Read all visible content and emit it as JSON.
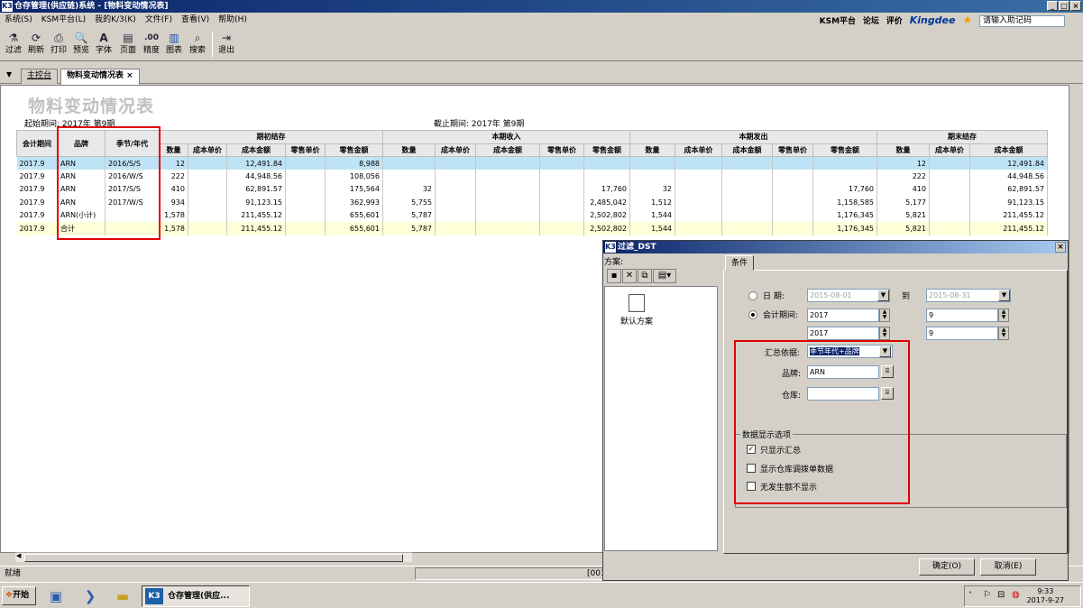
{
  "window": {
    "title": "仓存管理(供应链)系统 - [物料变动情况表]",
    "icon": "K3"
  },
  "menubar": {
    "items": [
      "系统(S)",
      "KSM平台(L)",
      "我的K/3(K)",
      "文件(F)",
      "查看(V)",
      "帮助(H)"
    ],
    "right": {
      "ksm": "KSM平台",
      "forum": "论坛",
      "rate": "评价",
      "brand": "Kingdee",
      "help_placeholder": "请输入助记码"
    }
  },
  "toolbar": {
    "items": [
      {
        "label": "过滤",
        "icon": "filter-icon",
        "glyph": "⚗"
      },
      {
        "label": "刷新",
        "icon": "refresh-icon",
        "glyph": "⟳"
      },
      {
        "label": "打印",
        "icon": "print-icon",
        "glyph": "⎙"
      },
      {
        "label": "预览",
        "icon": "preview-icon",
        "glyph": "🔍"
      },
      {
        "label": "字体",
        "icon": "font-icon",
        "glyph": "A"
      },
      {
        "label": "页面",
        "icon": "page-icon",
        "glyph": "▤"
      },
      {
        "label": "精度",
        "icon": "precision-icon",
        "glyph": ".00"
      },
      {
        "label": "图表",
        "icon": "chart-icon",
        "glyph": "▥"
      },
      {
        "label": "搜索",
        "icon": "search-icon",
        "glyph": "⌕"
      },
      {
        "label": "退出",
        "icon": "exit-icon",
        "glyph": "⇥"
      }
    ]
  },
  "tabs": [
    {
      "label": "主控台"
    },
    {
      "label": "物料变动情况表"
    }
  ],
  "tab_close": "×",
  "report": {
    "title": "物料变动情况表",
    "start_period": "起始期间: 2017年 第9期",
    "end_period": "截止期间: 2017年 第9期",
    "group_headers": [
      "期初结存",
      "本期收入",
      "本期发出",
      "期末结存"
    ],
    "left_headers": [
      "会计期间",
      "品牌",
      "季节/年代"
    ],
    "sub_headers": [
      "数量",
      "成本单价",
      "成本金额",
      "零售单价",
      "零售金额"
    ],
    "rows": [
      [
        "2017.9",
        "ARN",
        "2016/S/S",
        "12",
        "",
        "12,491.84",
        "",
        "8,988",
        "",
        "",
        "",
        "",
        "",
        "",
        "",
        "",
        "",
        "",
        "12",
        "",
        "12,491.84"
      ],
      [
        "2017.9",
        "ARN",
        "2016/W/S",
        "222",
        "",
        "44,948.56",
        "",
        "108,056",
        "",
        "",
        "",
        "",
        "",
        "",
        "",
        "",
        "",
        "",
        "222",
        "",
        "44,948.56"
      ],
      [
        "2017.9",
        "ARN",
        "2017/S/S",
        "410",
        "",
        "62,891.57",
        "",
        "175,564",
        "32",
        "",
        "",
        "",
        "17,760",
        "32",
        "",
        "",
        "",
        "17,760",
        "410",
        "",
        "62,891.57"
      ],
      [
        "2017.9",
        "ARN",
        "2017/W/S",
        "934",
        "",
        "91,123.15",
        "",
        "362,993",
        "5,755",
        "",
        "",
        "",
        "2,485,042",
        "1,512",
        "",
        "",
        "",
        "1,158,585",
        "5,177",
        "",
        "91,123.15"
      ],
      [
        "2017.9",
        "ARN(小计)",
        "",
        "1,578",
        "",
        "211,455.12",
        "",
        "655,601",
        "5,787",
        "",
        "",
        "",
        "2,502,802",
        "1,544",
        "",
        "",
        "",
        "1,176,345",
        "5,821",
        "",
        "211,455.12"
      ],
      [
        "2017.9",
        "合计",
        "",
        "1,578",
        "",
        "211,455.12",
        "",
        "655,601",
        "5,787",
        "",
        "",
        "",
        "2,502,802",
        "1,544",
        "",
        "",
        "",
        "1,176,345",
        "5,821",
        "",
        "211,455.12"
      ]
    ]
  },
  "statusbar": {
    "text": "就绪",
    "pane2": "[001"
  },
  "taskbar": {
    "start": "开始",
    "item": "仓存管理(供应...",
    "tray_time": "9:33",
    "tray_date": "2017-9-27"
  },
  "dialog": {
    "title": "过滤_DST",
    "scheme_label": "方案:",
    "scheme_default": "默认方案",
    "tab_label": "条件",
    "date_label": "日    期:",
    "date_from": "2015-08-01",
    "to_label": "到",
    "date_to": "2015-08-31",
    "period_label": "会计期间:",
    "period_year1": "2017",
    "period_no1": "9",
    "period_year2": "2017",
    "period_no2": "9",
    "group_by_label": "汇总依据:",
    "group_by_value": "季节年代+品牌",
    "brand_label": "品牌:",
    "brand_value": "ARN",
    "warehouse_label": "仓库:",
    "warehouse_value": "",
    "options_title": "数据显示选项",
    "options": [
      {
        "label": "只显示汇总",
        "checked": true
      },
      {
        "label": "显示仓库调拨单数据",
        "checked": false
      },
      {
        "label": "无发生额不显示",
        "checked": false
      }
    ],
    "ok_label": "确定(O)",
    "cancel_label": "取消(E)"
  },
  "colors": {
    "highlight_box": "#e00000",
    "selected_row": "#bfe3f6",
    "total_row": "#ffffd8",
    "title_bar": "#0a246a"
  }
}
